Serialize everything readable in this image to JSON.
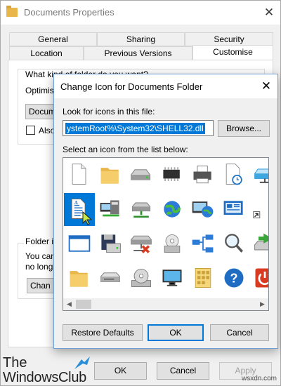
{
  "window": {
    "title": "Documents Properties",
    "close_glyph": "✕"
  },
  "tabs_row1": [
    {
      "label": "General"
    },
    {
      "label": "Sharing"
    },
    {
      "label": "Security"
    }
  ],
  "tabs_row2": [
    {
      "label": "Location"
    },
    {
      "label": "Previous Versions"
    },
    {
      "label": "Customise"
    }
  ],
  "background": {
    "question": "What kind of folder do you want?",
    "optimise": "Optimise",
    "combo": "Docum",
    "also": "Also",
    "folder_icon": "Folder ic",
    "you_can": "You can",
    "no_longer": "no longe",
    "change_btn": "Chan"
  },
  "bottom_buttons": {
    "ok": "OK",
    "cancel": "Cancel",
    "apply": "Apply"
  },
  "dialog": {
    "title": "Change Icon for Documents Folder",
    "close_glyph": "✕",
    "look_label": "Look for icons in this file:",
    "path_value": "ystemRoot%\\System32\\SHELL32.dll",
    "browse": "Browse...",
    "select_label": "Select an icon from the list below:",
    "restore": "Restore Defaults",
    "ok": "OK",
    "cancel": "Cancel",
    "icons": [
      "blank-document-icon",
      "folder-icon",
      "hard-drive-icon",
      "memory-chip-icon",
      "printer-icon",
      "document-clock-icon",
      "network-drive-icon",
      "text-document-icon",
      "network-pc-icon",
      "network-share-icon",
      "globe-icon",
      "network-globe-icon",
      "control-panel-icon",
      "shortcut-arrow-icon",
      "window-icon",
      "floppy-disk-icon",
      "network-drive-error-icon",
      "cd-drive-icon",
      "network-connection-icon",
      "search-icon",
      "recycle-arrow-icon",
      "folder-icon",
      "drive-icon",
      "cd-disc-icon",
      "monitor-icon",
      "folder-grid-icon",
      "help-icon",
      "power-icon"
    ]
  },
  "watermark": {
    "line1": "The",
    "line2": "WindowsClub",
    "site": "wsxdn.com"
  },
  "colors": {
    "accent": "#0078d7",
    "folder": "#e8b64a",
    "power": "#d83b22",
    "help": "#1f6dc2"
  }
}
